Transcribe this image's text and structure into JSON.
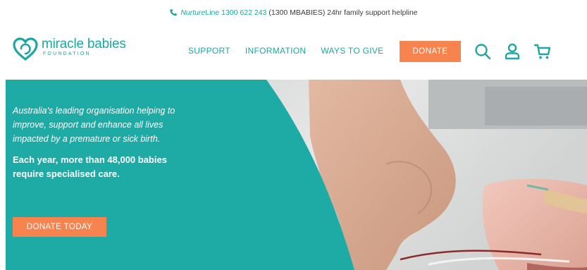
{
  "topbar": {
    "phone_icon": "phone-icon",
    "nurture_prefix": "Nurture",
    "nurture_line": "Line 1300 622 243",
    "rest": "(1300 MBABIES) 24hr family support helpline"
  },
  "logo": {
    "name": "miracle babies",
    "sub": "FOUNDATION"
  },
  "nav": {
    "items": [
      {
        "label": "SUPPORT"
      },
      {
        "label": "INFORMATION"
      },
      {
        "label": "WAYS TO GIVE"
      }
    ],
    "donate_label": "DONATE",
    "icons": [
      "search-icon",
      "account-icon",
      "cart-icon"
    ]
  },
  "hero": {
    "tagline": "Australia's leading organisation helping to improve, support and enhance all lives impacted by a premature or sick birth.",
    "stat": "Each year, more than 48,000 babies require specialised care.",
    "cta_label": "DONATE TODAY"
  },
  "colors": {
    "teal": "#1fa6a1",
    "hero_teal": "#1eaba5",
    "orange": "#f7834f"
  }
}
